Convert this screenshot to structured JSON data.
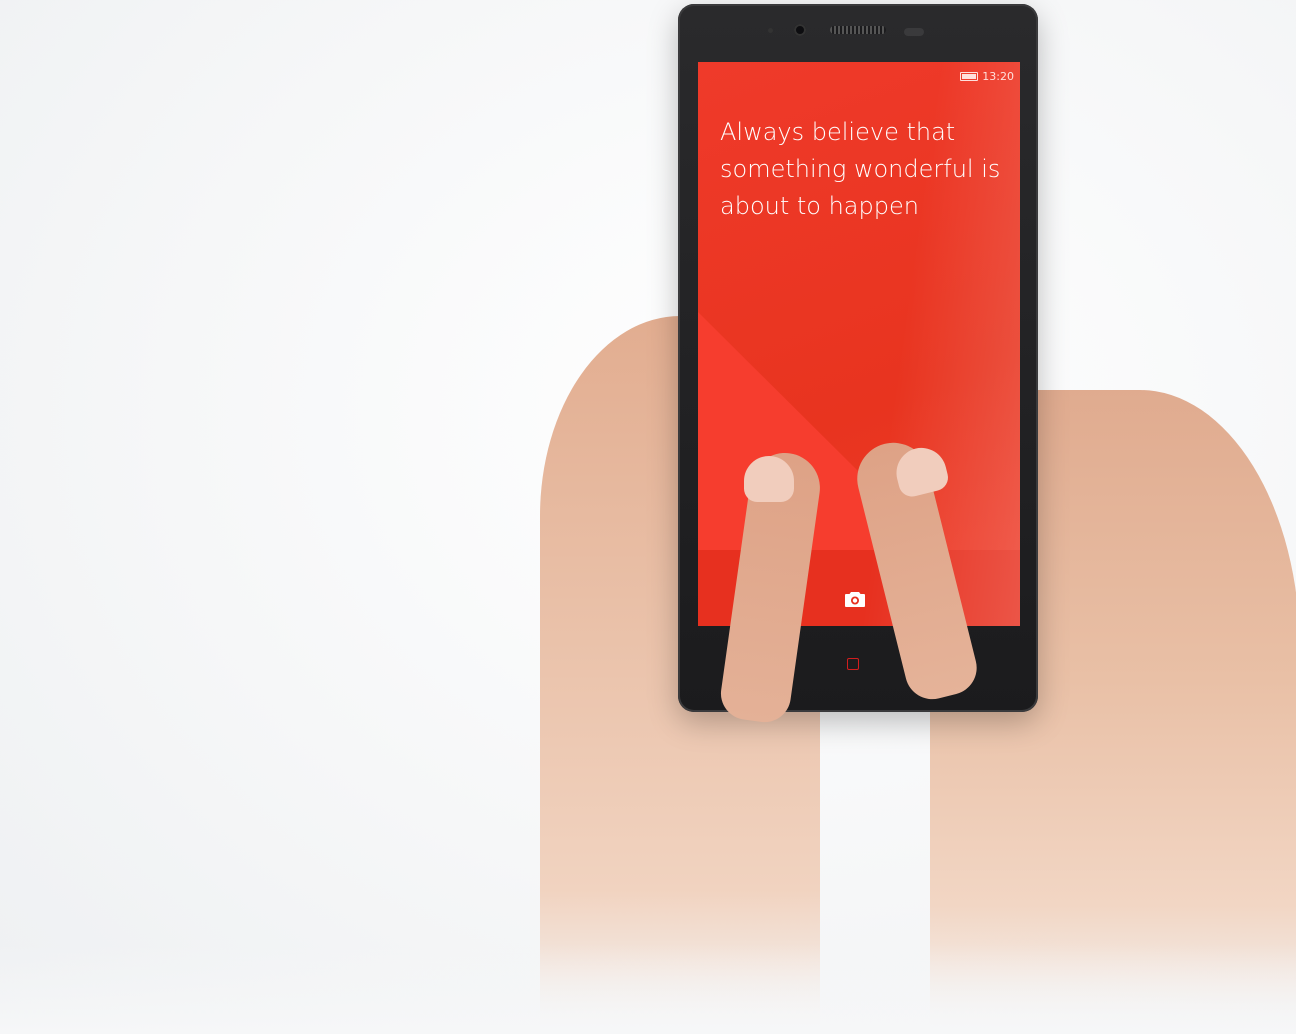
{
  "phone": {
    "status_time": "13:20",
    "quote": "Always believe that\nsomething wonderful is\nabout to happen",
    "lockscreen_shortcut_icon": "camera-icon",
    "nav_icons": [
      "home-icon",
      "back-icon"
    ]
  },
  "colors": {
    "screen_red": "#E8341F",
    "accent_red": "#D21E1E",
    "phone_body": "#1B1B1D"
  }
}
